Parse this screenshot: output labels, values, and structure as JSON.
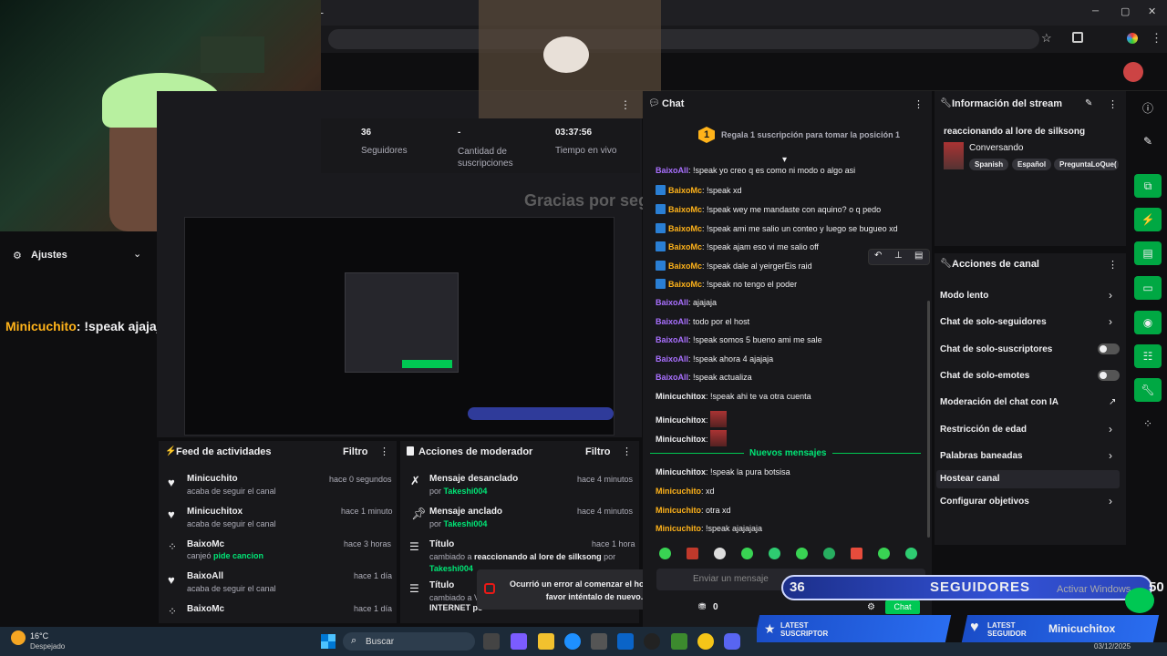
{
  "browser": {
    "new_tab": "+",
    "minimize": "─",
    "maximize": "▢",
    "close": "✕"
  },
  "ajustes": {
    "label": "Ajustes"
  },
  "overlay_chat": {
    "user": "Minicuchito",
    "message": ": !speak ajajajaja"
  },
  "watermark": "Gracias por seguirme!",
  "stats": [
    {
      "value": "36",
      "label": "Seguidores"
    },
    {
      "value": "-",
      "label": "Cantidad de suscripciones"
    },
    {
      "value": "03:37:56",
      "label": "Tiempo en vivo"
    }
  ],
  "chat": {
    "title": "Chat",
    "gift_rank": "1",
    "gift_text": "Regala 1 suscripción para tomar la posición 1",
    "messages": [
      {
        "user": "BaixoAll",
        "color": "#a970ff",
        "badge": false,
        "text": "!speak yo creo q es como ni modo o algo asi"
      },
      {
        "user": "BaixoMc",
        "color": "#ffb31a",
        "badge": true,
        "text": "!speak xd"
      },
      {
        "user": "BaixoMc",
        "color": "#ffb31a",
        "badge": true,
        "text": "!speak wey me mandaste con aquino? o q pedo"
      },
      {
        "user": "BaixoMc",
        "color": "#ffb31a",
        "badge": true,
        "text": "!speak ami me salio un conteo y luego se bugueo xd"
      },
      {
        "user": "BaixoMc",
        "color": "#ffb31a",
        "badge": true,
        "text": "!speak ajam eso vi me salio off"
      },
      {
        "user": "BaixoMc",
        "color": "#ffb31a",
        "badge": true,
        "text": "!speak dale al yeirgerEis raid"
      },
      {
        "user": "BaixoMc",
        "color": "#ffb31a",
        "badge": true,
        "text": "!speak no tengo el poder"
      },
      {
        "user": "BaixoAll",
        "color": "#a970ff",
        "badge": false,
        "text": "ajajaja"
      },
      {
        "user": "BaixoAll",
        "color": "#a970ff",
        "badge": false,
        "text": "todo por el host"
      },
      {
        "user": "BaixoAll",
        "color": "#a970ff",
        "badge": false,
        "text": "!speak somos 5 bueno ami me sale"
      },
      {
        "user": "BaixoAll",
        "color": "#a970ff",
        "badge": false,
        "text": "!speak ahora 4 ajajaja"
      },
      {
        "user": "BaixoAll",
        "color": "#a970ff",
        "badge": false,
        "text": "!speak actualiza"
      },
      {
        "user": "Minicuchitox",
        "color": "#efeff1",
        "badge": false,
        "text": "!speak ahi te va otra cuenta"
      },
      {
        "user": "Minicuchitox",
        "color": "#efeff1",
        "badge": false,
        "text": ""
      },
      {
        "user": "Minicuchitox",
        "color": "#efeff1",
        "badge": false,
        "text": ""
      }
    ],
    "new_messages": "Nuevos mensajes",
    "new": [
      {
        "user": "Minicuchitox",
        "color": "#efeff1",
        "text": "!speak la pura botsisa"
      },
      {
        "user": "Minicuchito",
        "color": "#ffb31a",
        "text": "xd"
      },
      {
        "user": "Minicuchito",
        "color": "#ffb31a",
        "text": "otra xd"
      },
      {
        "user": "Minicuchito",
        "color": "#ffb31a",
        "text": "!speak ajajajaja"
      }
    ],
    "input_placeholder": "Enviar un mensaje",
    "points": "0",
    "send": "Chat"
  },
  "stream_info": {
    "title": "Información del stream",
    "stream_title": "reaccionando al lore de silksong",
    "category": "Conversando",
    "tags": [
      "Spanish",
      "Español",
      "PreguntaLoQue("
    ]
  },
  "acciones": {
    "title": "Acciones de canal",
    "items": [
      {
        "label": "Modo lento",
        "control": "chevron"
      },
      {
        "label": "Chat de solo-seguidores",
        "control": "chevron"
      },
      {
        "label": "Chat de solo-suscriptores",
        "control": "toggle"
      },
      {
        "label": "Chat de solo-emotes",
        "control": "toggle"
      },
      {
        "label": "Moderación del chat con IA",
        "control": "external"
      },
      {
        "label": "Restricción de edad",
        "control": "chevron"
      },
      {
        "label": "Palabras baneadas",
        "control": "chevron"
      },
      {
        "label": "Hostear canal",
        "control": "none"
      },
      {
        "label": "Configurar objetivos",
        "control": "chevron"
      }
    ]
  },
  "feed": {
    "title": "Feed de actividades",
    "filter": "Filtro",
    "items": [
      {
        "name": "Minicuchito",
        "time": "hace 0 segundos",
        "desc": "acaba de seguir el canal",
        "icon": "heart-icon"
      },
      {
        "name": "Minicuchitox",
        "time": "hace 1 minuto",
        "desc": "acaba de seguir el canal",
        "icon": "heart-icon"
      },
      {
        "name": "BaixoMc",
        "time": "hace 3 horas",
        "desc": "canjeó ",
        "extra": "pide cancion",
        "icon": "points-icon"
      },
      {
        "name": "BaixoAll",
        "time": "hace 1 día",
        "desc": "acaba de seguir el canal",
        "icon": "heart-icon"
      },
      {
        "name": "BaixoMc",
        "time": "hace 1 día",
        "desc": "",
        "icon": "points-icon"
      }
    ]
  },
  "mod_actions": {
    "title": "Acciones de moderador",
    "filter": "Filtro",
    "items": [
      {
        "name": "Mensaje desanclado",
        "time": "hace 4 minutos",
        "by": "por ",
        "who": "Takeshi004"
      },
      {
        "name": "Mensaje anclado",
        "time": "hace 4 minutos",
        "by": "por ",
        "who": "Takeshi004"
      },
      {
        "name": "Título",
        "time": "hace 1 hora",
        "by": "cambiado a ",
        "who": "reaccionando al lore de silksong",
        "after": " por",
        "who2": "Takeshi004"
      },
      {
        "name": "Título",
        "time": "hace 1 día",
        "by": "cambiado a V",
        "who": "",
        "after": "INTERNET po",
        "who2": ""
      }
    ]
  },
  "toast": "Ocurrió un error al comenzar el hosteo. Por favor inténtalo de nuevo.",
  "followers_overlay": {
    "count": "36",
    "label": "SEGUIDORES",
    "goal": "50"
  },
  "latest_sub": {
    "line1": "LATEST",
    "line2": "SUSCRIPTOR"
  },
  "latest_follower": {
    "line1": "LATEST",
    "line2": "SEGUIDOR",
    "name": "Minicuchitox"
  },
  "activate_windows": "Activar Windows",
  "taskbar": {
    "temp": "16°C",
    "weather": "Despejado",
    "search": "Buscar",
    "date": "03/12/2025"
  }
}
